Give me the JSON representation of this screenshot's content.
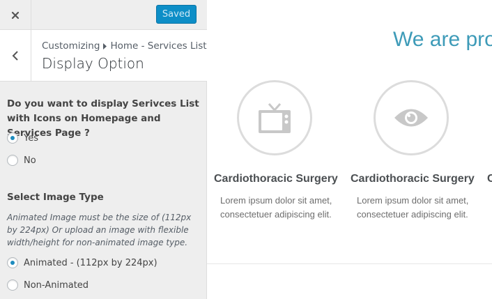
{
  "topbar": {
    "close_icon": "close-icon",
    "saved_label": "Saved"
  },
  "header": {
    "breadcrumb_root": "Customizing",
    "breadcrumb_section": "Home - Services List",
    "title": "Display Option"
  },
  "display_option": {
    "question": "Do you want to display Serivces List with Icons on Homepage and Services Page ?",
    "options": [
      {
        "label": "Yes",
        "checked": true
      },
      {
        "label": "No",
        "checked": false
      }
    ]
  },
  "image_type": {
    "heading": "Select Image Type",
    "description": "Animated Image must be the size of (112px by 224px) Or upload an image with flexible width/height for non-animated image type.",
    "options": [
      {
        "label": "Animated - (112px by 224px)",
        "checked": true
      },
      {
        "label": "Non-Animated",
        "checked": false
      }
    ]
  },
  "preview": {
    "headline": "We are pro",
    "services": [
      {
        "icon": "tv-icon",
        "title": "Cardiothoracic Surgery",
        "text": "Lorem ipsum dolor sit amet, consectetuer adipiscing elit."
      },
      {
        "icon": "eye-icon",
        "title": "Cardiothoracic Surgery",
        "text": "Lorem ipsum dolor sit amet, consectetuer adipiscing elit."
      },
      {
        "title": "C"
      }
    ]
  },
  "colors": {
    "accent": "#0d8ec7",
    "headline": "#3e9bb8",
    "radio_dot": "#1e8cbe"
  }
}
